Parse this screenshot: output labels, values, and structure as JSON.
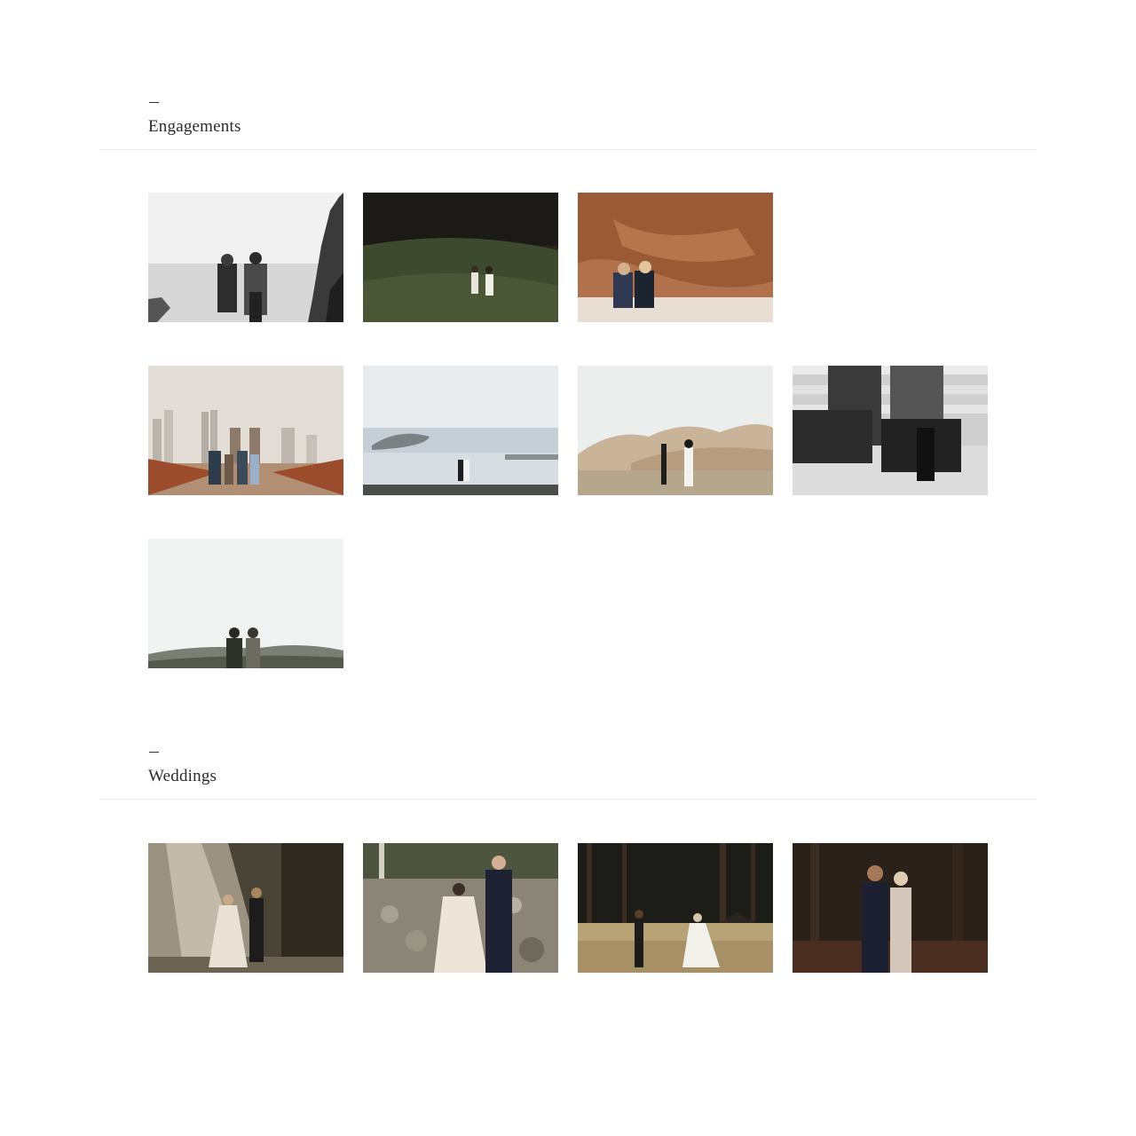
{
  "sections": [
    {
      "title": "Engagements",
      "dash": "—",
      "thumbnails": [
        {
          "name": "couple-on-rocky-beach",
          "tone": "bw"
        },
        {
          "name": "couple-in-dark-forest",
          "tone": "dark-green"
        },
        {
          "name": "couple-sitting-by-red-cliff",
          "tone": "warm"
        },
        {
          "name": "couples-on-brooklyn-bridge",
          "tone": "bridge"
        },
        {
          "name": "couple-by-ocean-pool",
          "tone": "sea"
        },
        {
          "name": "couple-in-grassy-hills",
          "tone": "hills"
        },
        {
          "name": "couple-sitting-on-steps",
          "tone": "bw-steps"
        },
        {
          "name": "couple-on-misty-hilltop",
          "tone": "mist"
        }
      ]
    },
    {
      "title": "Weddings",
      "dash": "—",
      "thumbnails": [
        {
          "name": "bride-groom-in-sunlit-mist",
          "tone": "haze"
        },
        {
          "name": "bride-groom-on-rocky-riverbed",
          "tone": "rocks"
        },
        {
          "name": "bride-groom-in-forest-meadow",
          "tone": "meadow"
        },
        {
          "name": "bride-groom-in-dark-woods",
          "tone": "dark-woods"
        }
      ]
    }
  ]
}
